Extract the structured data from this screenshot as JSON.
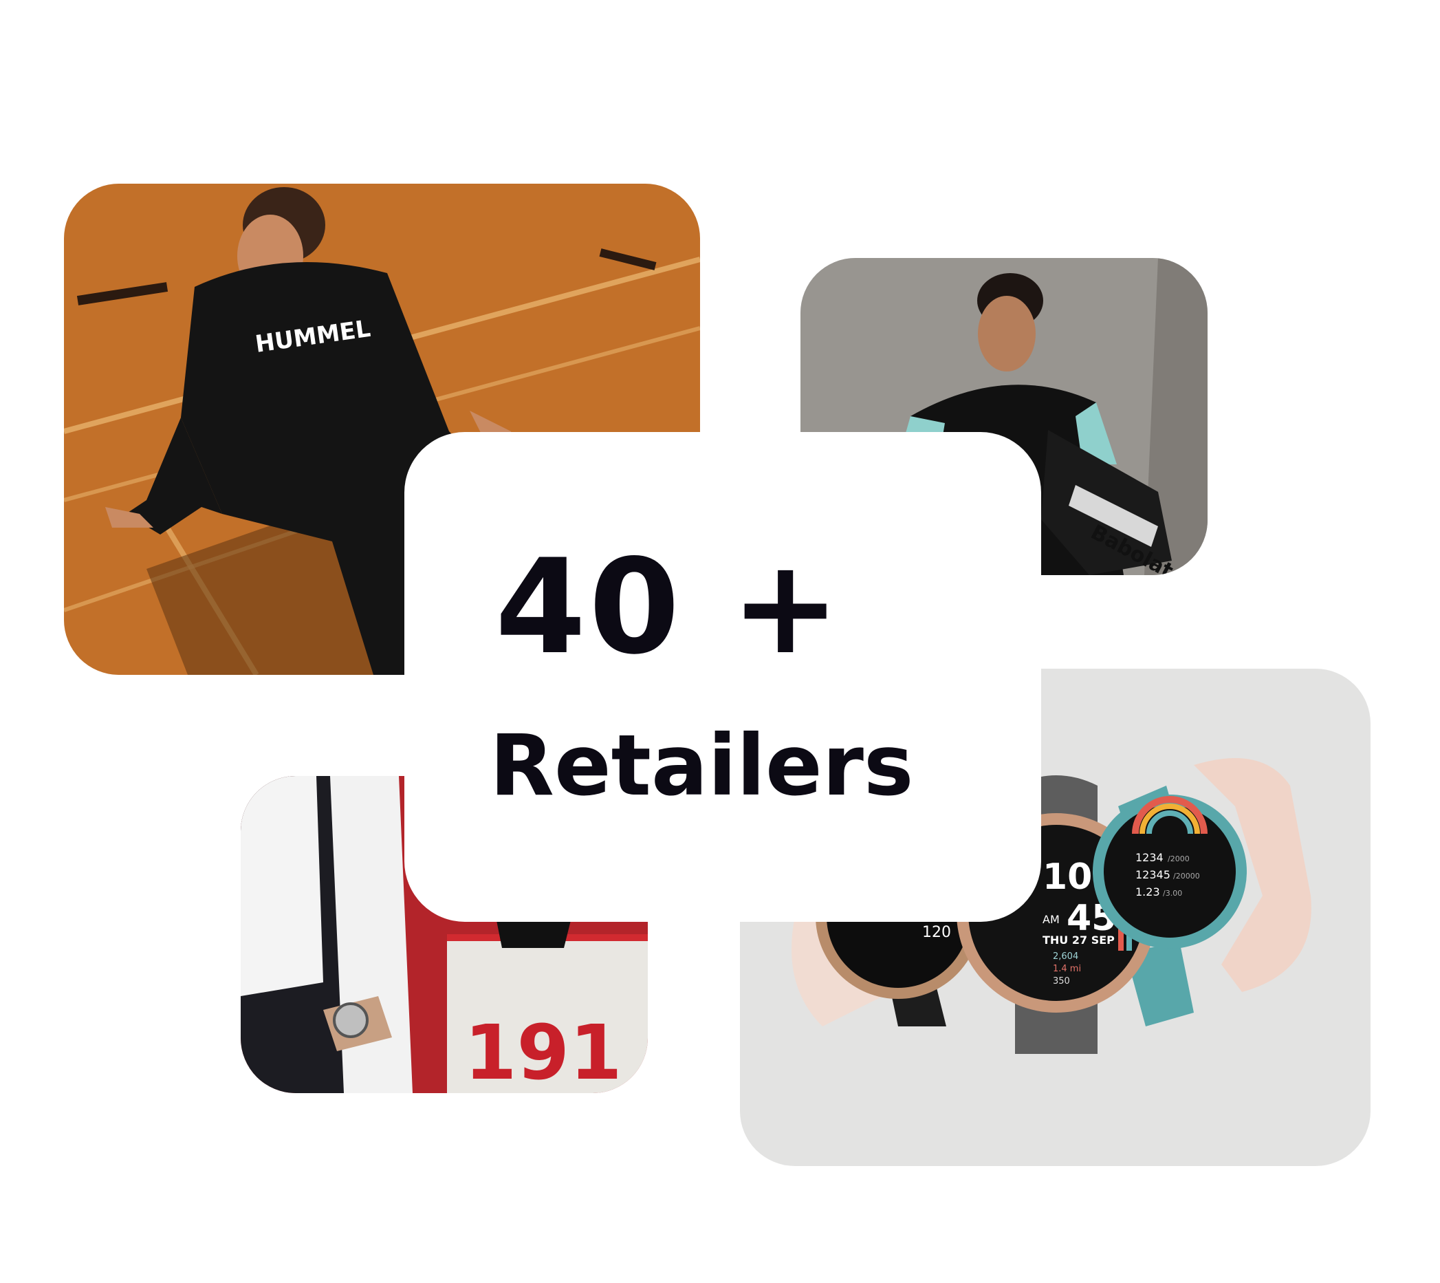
{
  "stat": {
    "number": "40 +",
    "label": "Retailers"
  },
  "photos": {
    "hummel": {
      "brand_text": "HUMMEL",
      "background": "#c9782e"
    },
    "babolat": {
      "brand_text": "Babolat",
      "background": "#8f8c88"
    },
    "fila": {
      "jersey_text": "191",
      "background": "#b3242a"
    },
    "watches": {
      "background": "#e3e3e2",
      "time_hour": "10",
      "time_minute": "45",
      "am_pm": "AM",
      "date": "THU 27 SEP",
      "stat_1": "2,604",
      "stat_2": "1.4 mi",
      "stat_3": "350",
      "goal_1": "1234",
      "goal_1_total": "/2000",
      "goal_2": "12345",
      "goal_2_total": "/20000",
      "goal_3": "1.23",
      "goal_3_total": "/3.00",
      "left_value": "120"
    }
  },
  "colors": {
    "text": "#0c0a14",
    "card": "#ffffff"
  }
}
